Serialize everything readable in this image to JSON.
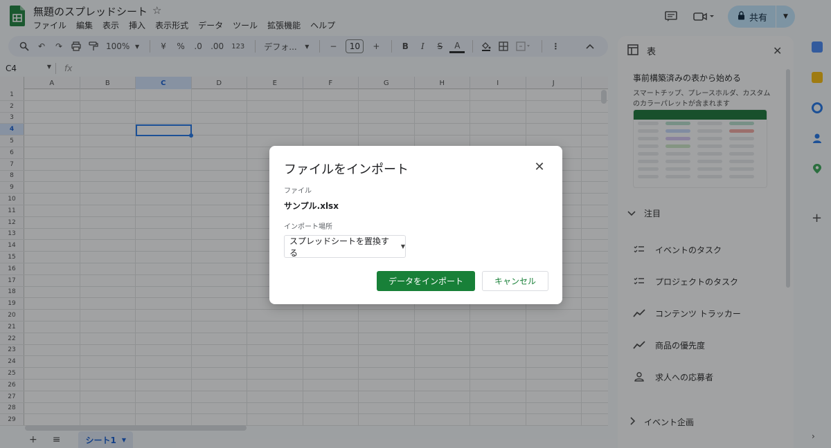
{
  "header": {
    "doc_title": "無題のスプレッドシート",
    "star": "☆",
    "menu": [
      "ファイル",
      "編集",
      "表示",
      "挿入",
      "表示形式",
      "データ",
      "ツール",
      "拡張機能",
      "ヘルプ"
    ],
    "share_label": "共有"
  },
  "toolbar": {
    "zoom": "100%",
    "currency": "¥",
    "percent": "%",
    "dec_decrease": ".0",
    "dec_increase": ".00",
    "number_format": "123",
    "font": "デフォ...",
    "font_size": "10",
    "bold": "B",
    "italic": "I",
    "strike": "S",
    "text_color": "A",
    "minus": "−",
    "plus": "+"
  },
  "formula_bar": {
    "name_box": "C4",
    "fx": "fx"
  },
  "grid": {
    "columns": [
      "A",
      "B",
      "C",
      "D",
      "E",
      "F",
      "G",
      "H",
      "I",
      "J"
    ],
    "selected_column": "C",
    "rows": [
      "1",
      "2",
      "3",
      "4",
      "5",
      "6",
      "7",
      "8",
      "9",
      "10",
      "11",
      "12",
      "13",
      "14",
      "15",
      "16",
      "17",
      "18",
      "19",
      "20",
      "21",
      "22",
      "23",
      "24",
      "25",
      "26",
      "27",
      "28",
      "29"
    ],
    "selected_row": "4"
  },
  "sheet_bar": {
    "add": "+",
    "list": "≡",
    "active_sheet": "シート1"
  },
  "side_panel": {
    "title": "表",
    "heading": "事前構築済みの表から始める",
    "description": "スマートチップ、プレースホルダ、カスタムのカラーパレットが含まれます",
    "section": "注目",
    "templates": [
      {
        "label": "イベントのタスク",
        "icon": "checklist-icon"
      },
      {
        "label": "プロジェクトのタスク",
        "icon": "checklist-icon"
      },
      {
        "label": "コンテンツ トラッカー",
        "icon": "trend-icon"
      },
      {
        "label": "商品の優先度",
        "icon": "trend-icon"
      },
      {
        "label": "求人への応募者",
        "icon": "person-icon"
      }
    ],
    "footer_section": "イベント企画"
  },
  "dialog": {
    "title": "ファイルをインポート",
    "file_label": "ファイル",
    "file_name": "サンプル.xlsx",
    "location_label": "インポート場所",
    "location_value": "スプレッドシートを置換する",
    "import_button": "データをインポート",
    "cancel_button": "キャンセル"
  },
  "colors": {
    "primary_green": "#188038",
    "selection_blue": "#1a73e8",
    "share_bg": "#c2e7ff"
  }
}
